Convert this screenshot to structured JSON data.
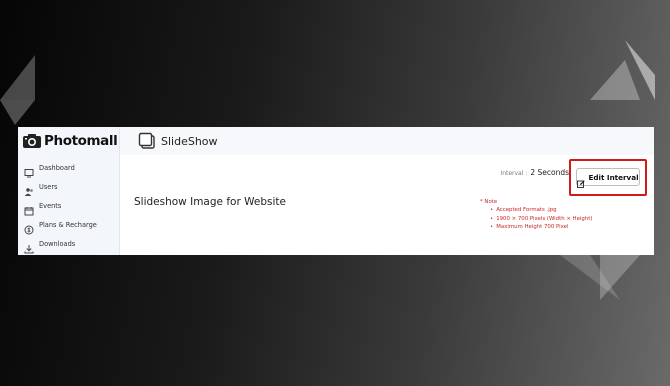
{
  "sidebar": {
    "brand": "Photomall",
    "items": [
      {
        "label": "Dashboard",
        "icon": "dashboard-icon"
      },
      {
        "label": "Users",
        "icon": "users-icon"
      },
      {
        "label": "Events",
        "icon": "events-icon"
      },
      {
        "label": "Plans & Recharge",
        "icon": "plans-icon"
      },
      {
        "label": "Downloads",
        "icon": "download-icon"
      }
    ]
  },
  "header": {
    "title": "SlideShow",
    "icon": "slideshow-icon"
  },
  "main": {
    "interval_label": "Interval :",
    "interval_value": "2 Seconds",
    "edit_button": "Edit Interval",
    "section_title": "Slideshow Image for Website",
    "notes_title": "* Note",
    "notes": [
      "Accepted Formats .jpg",
      "1900 × 700 Pixels (Width × Height)",
      "Maximum Height 700 Pixel"
    ]
  },
  "colors": {
    "highlight": "#d11a1a",
    "note": "#c62828"
  }
}
